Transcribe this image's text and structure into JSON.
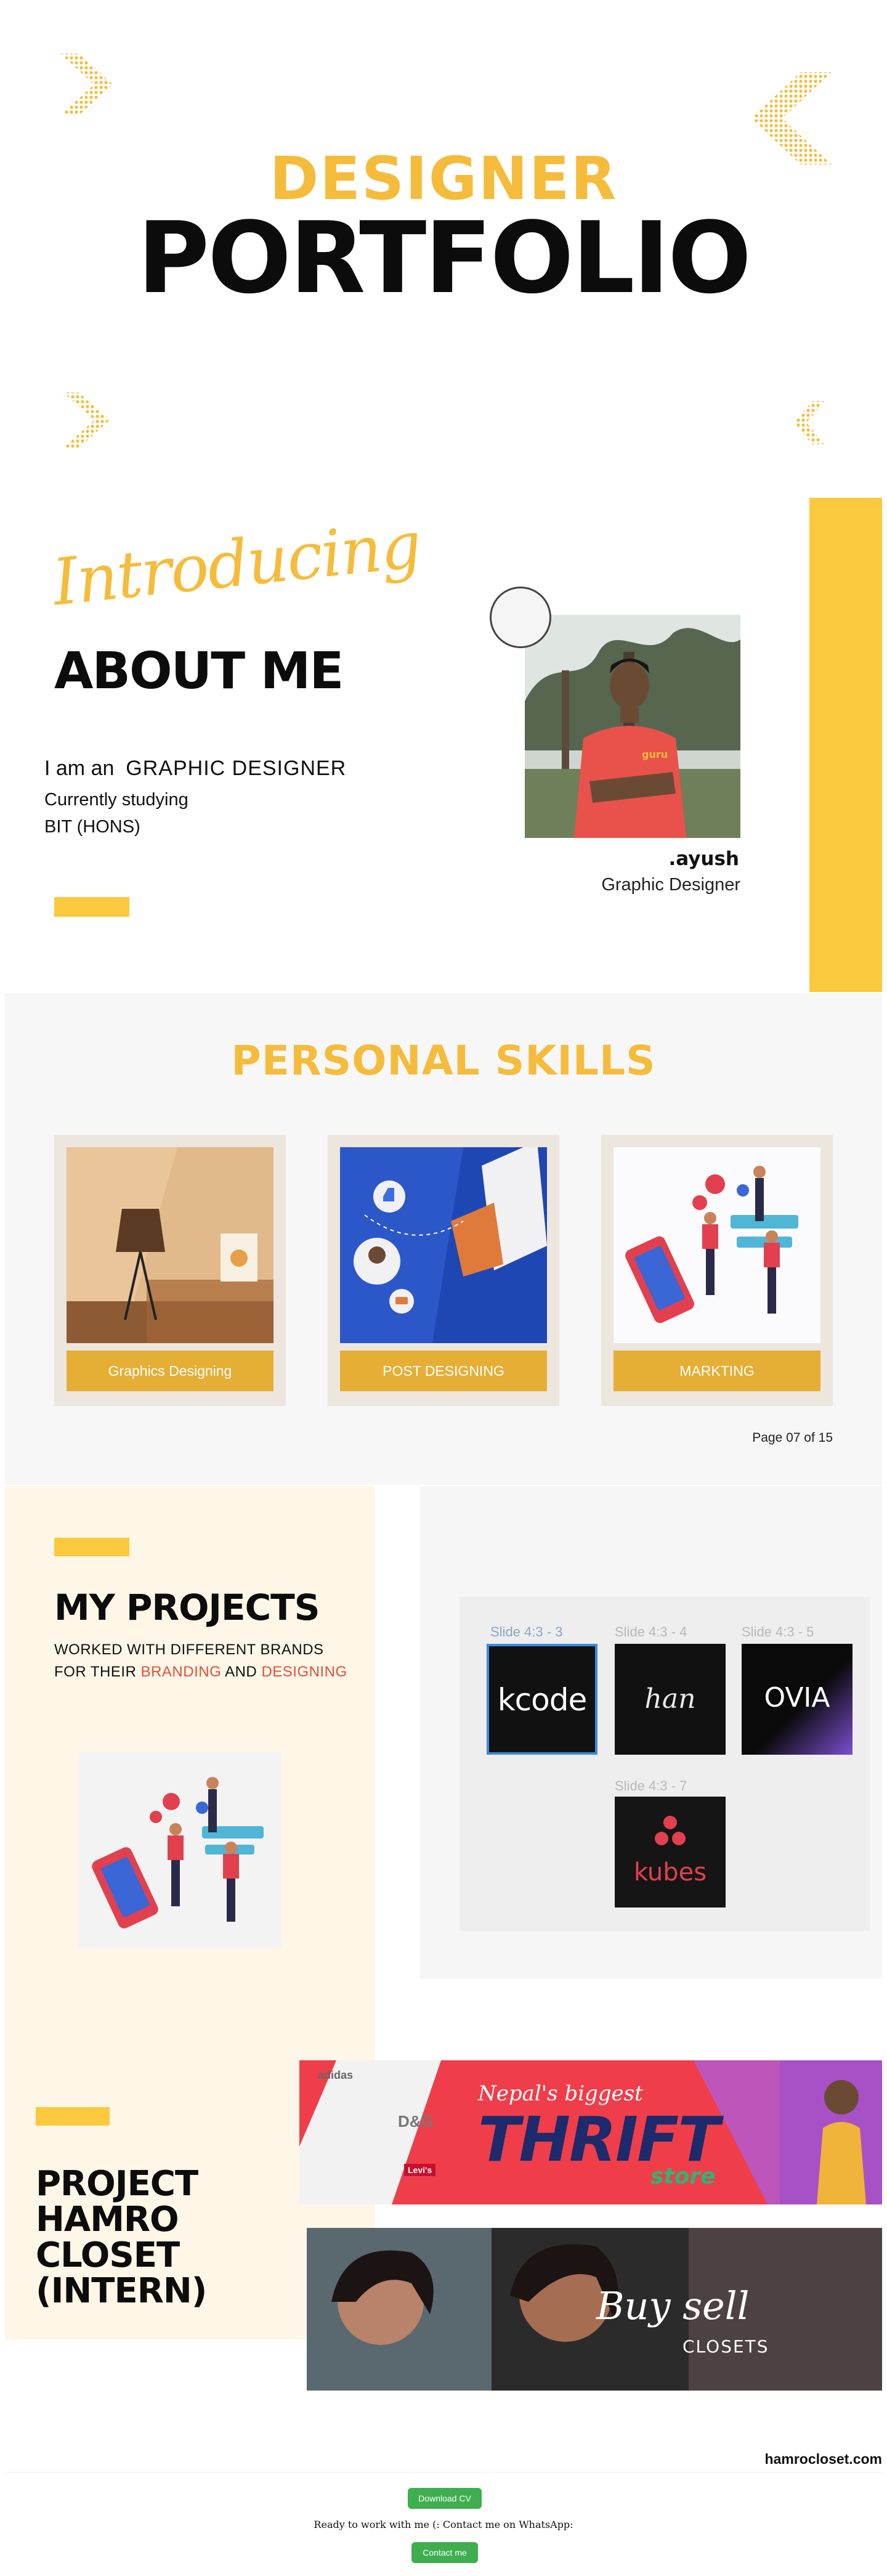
{
  "hero": {
    "title_top": "DESIGNER",
    "title_main": "PORTFOLIO"
  },
  "about": {
    "intro": "Introducing",
    "title": "ABOUT ME",
    "role_prefix": "I am an",
    "role": "GRAPHIC DESIGNER",
    "study_line1": "Currently studying",
    "study_line2": "BIT (HONS)",
    "name": ".ayush",
    "subtitle": "Graphic Designer",
    "shirt_text": "guru"
  },
  "skills": {
    "title": "PERSONAL SKILLS",
    "items": [
      {
        "label": "Graphics Designing",
        "icon": "interior-lamp-icon"
      },
      {
        "label": "POST DESIGNING",
        "icon": "megaphone-social-icon"
      },
      {
        "label": "MARKTING",
        "icon": "mobile-marketing-icon"
      }
    ],
    "page": "Page 07 of 15"
  },
  "projects": {
    "title": "MY PROJECTS",
    "line1": "WORKED WITH DIFFERENT BRANDS",
    "line2_a": "FOR THEIR ",
    "line2_b": "BRANDING",
    "line2_c": " AND ",
    "line2_d": "DESIGNING",
    "slides": [
      {
        "label": "Slide 4:3 - 3",
        "brand": "kcode"
      },
      {
        "label": "Slide 4:3 - 4",
        "brand": "han"
      },
      {
        "label": "Slide 4:3 - 5",
        "brand": "OVIA"
      },
      {
        "label": "Slide 4:3 - 7",
        "brand": "kubes"
      }
    ]
  },
  "hamro": {
    "title_l1": "PROJECT",
    "title_l2": "HAMRO",
    "title_l3": "CLOSET",
    "title_l4": "(INTERN)",
    "banner1_top": "Nepal's biggest",
    "banner1_main": "THRIFT",
    "banner1_sub": "store",
    "banner1_brands": [
      "adidas",
      "D&G",
      "Levi's"
    ],
    "banner2_script": "Buy sell",
    "banner2_sub": "CLOSETS",
    "domain": "hamrocloset.com"
  },
  "footer": {
    "download_label": "Download CV",
    "text": "Ready to work with me (: Contact me on WhatsApp:",
    "contact_label": "Contact me"
  },
  "colors": {
    "accent": "#F5BC3C",
    "accent_dark": "#E5AE35",
    "highlight": "#E0513C",
    "green": "#3fae4f"
  }
}
